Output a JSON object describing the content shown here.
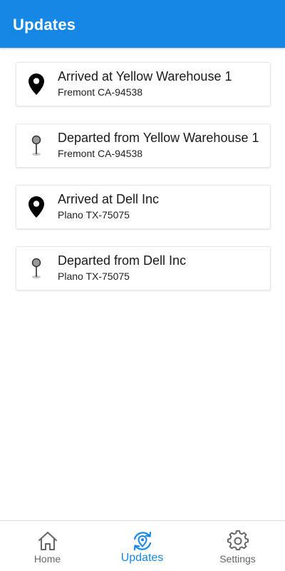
{
  "header": {
    "title": "Updates"
  },
  "updates": [
    {
      "title": "Arrived at Yellow Warehouse 1",
      "location": "Fremont CA-94538",
      "icon": "map-marker-icon"
    },
    {
      "title": "Departed from Yellow Warehouse 1",
      "location": "Fremont CA-94538",
      "icon": "pushpin-icon"
    },
    {
      "title": "Arrived at Dell Inc",
      "location": "Plano TX-75075",
      "icon": "map-marker-icon"
    },
    {
      "title": "Departed from Dell Inc",
      "location": "Plano TX-75075",
      "icon": "pushpin-icon"
    }
  ],
  "bottom_nav": {
    "items": [
      {
        "label": "Home",
        "icon": "home-icon",
        "active": false
      },
      {
        "label": "Updates",
        "icon": "updates-icon",
        "active": true
      },
      {
        "label": "Settings",
        "icon": "gear-icon",
        "active": false
      }
    ]
  },
  "colors": {
    "primary": "#1787e6",
    "inactive": "#666666"
  }
}
